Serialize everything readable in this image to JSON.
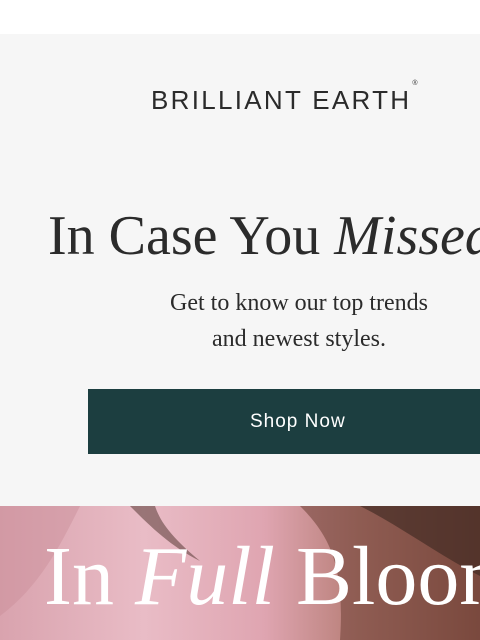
{
  "brand": {
    "name": "BRILLIANT EARTH",
    "trademark": "®"
  },
  "hero": {
    "headline_plain": "In Case You ",
    "headline_italic": "Missed",
    "subtext_line1": "Get to know our top trends",
    "subtext_line2": "and newest styles.",
    "button_label": "Shop Now"
  },
  "banner": {
    "title_plain_1": "In ",
    "title_italic": "Full",
    "title_plain_2": " Bloom"
  },
  "colors": {
    "hero_background": "#f6f6f6",
    "button": "#1c3e40",
    "text": "#2b2b2b"
  }
}
